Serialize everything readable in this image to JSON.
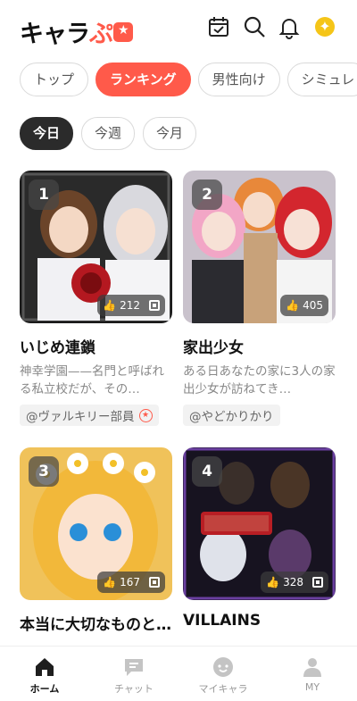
{
  "app": {
    "logo_main": "キャラ",
    "logo_accent": "ぷ"
  },
  "header_icons": [
    "calendar-check-icon",
    "search-icon",
    "bell-icon",
    "coin-icon"
  ],
  "coin": {
    "symbol": "✦"
  },
  "category_tabs": [
    {
      "label": "トップ",
      "active": false
    },
    {
      "label": "ランキング",
      "active": true
    },
    {
      "label": "男性向け",
      "active": false
    },
    {
      "label": "シミュレ",
      "active": false
    }
  ],
  "period_tabs": [
    {
      "label": "今日",
      "active": true
    },
    {
      "label": "今週",
      "active": false
    },
    {
      "label": "今月",
      "active": false
    }
  ],
  "cards": [
    {
      "rank": "1",
      "likes": "212",
      "title": "いじめ連鎖",
      "desc": "神幸学園——名門と呼ばれる私立校だが、その…",
      "author": "@ヴァルキリー部員",
      "verified": true
    },
    {
      "rank": "2",
      "likes": "405",
      "title": "家出少女",
      "desc": "ある日あなたの家に3人の家出少女が訪ねてき…",
      "author": "@やどかりかり",
      "verified": false
    },
    {
      "rank": "3",
      "likes": "167",
      "title": "本当に大切なものと…",
      "desc": "",
      "author": "",
      "verified": false
    },
    {
      "rank": "4",
      "likes": "328",
      "title": "VILLAINS",
      "desc": "",
      "author": "",
      "verified": false
    }
  ],
  "bottom_nav": [
    {
      "label": "ホーム",
      "active": true
    },
    {
      "label": "チャット",
      "active": false
    },
    {
      "label": "マイキャラ",
      "active": false
    },
    {
      "label": "MY",
      "active": false
    }
  ],
  "colors": {
    "accent": "#ff5a4a",
    "dark": "#2b2b2b",
    "coin": "#f5c518"
  }
}
